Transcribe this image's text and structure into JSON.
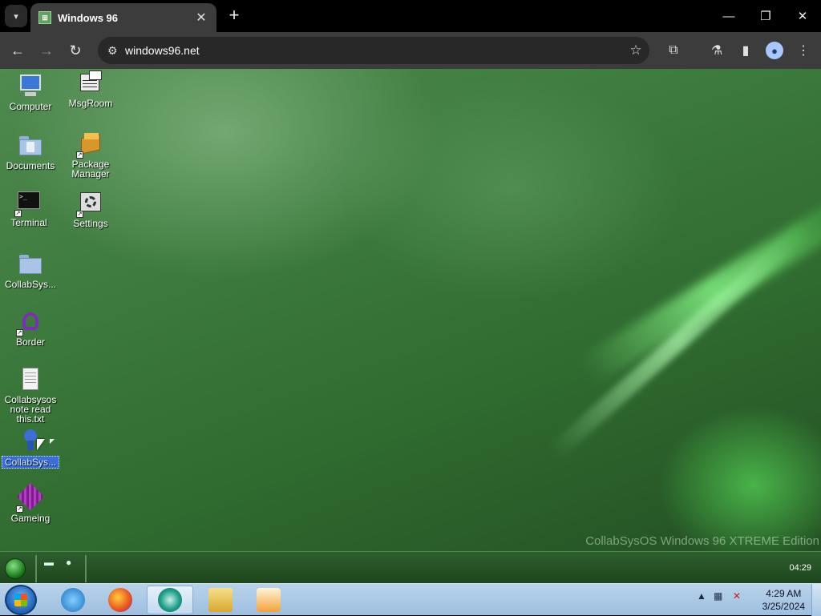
{
  "browser": {
    "tab_title": "Windows 96",
    "url": "windows96.net"
  },
  "desktop": {
    "icons": [
      {
        "label": "Computer"
      },
      {
        "label": "MsgRoom"
      },
      {
        "label": "Documents"
      },
      {
        "label": "Package Manager"
      },
      {
        "label": "Terminal"
      },
      {
        "label": "Settings"
      },
      {
        "label": "CollabSys..."
      },
      {
        "label": "Border"
      },
      {
        "label": "Collabsysos note read this.txt"
      },
      {
        "label": "CollabSys..."
      },
      {
        "label": "Gameing"
      }
    ],
    "watermark": "CollabSysOS Windows 96 XTREME Edition"
  },
  "w96_taskbar": {
    "clock": "04:29"
  },
  "win7_taskbar": {
    "time": "4:29 AM",
    "date": "3/25/2024"
  }
}
